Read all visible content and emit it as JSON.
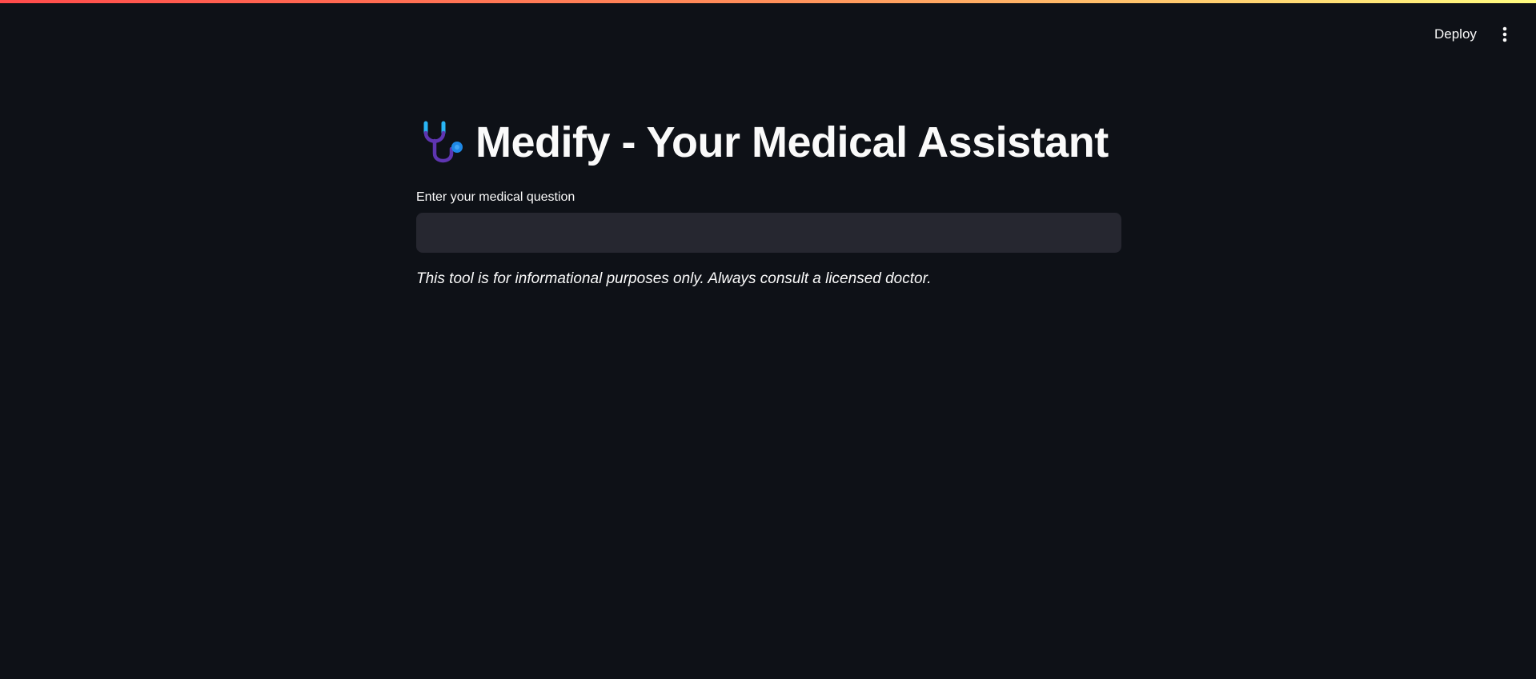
{
  "header": {
    "deploy_label": "Deploy",
    "menu_icon": "vertical-dots-icon"
  },
  "title": {
    "icon": "stethoscope-icon",
    "text": "Medify - Your Medical Assistant"
  },
  "question": {
    "label": "Enter your medical question",
    "value": "",
    "placeholder": ""
  },
  "disclaimer": "This tool is for informational purposes only. Always consult a licensed doctor.",
  "colors": {
    "background": "#0e1117",
    "input_background": "#262730",
    "text": "#fafafa",
    "accent_gradient_start": "#ff4b4b",
    "accent_gradient_end": "#fffd80"
  }
}
